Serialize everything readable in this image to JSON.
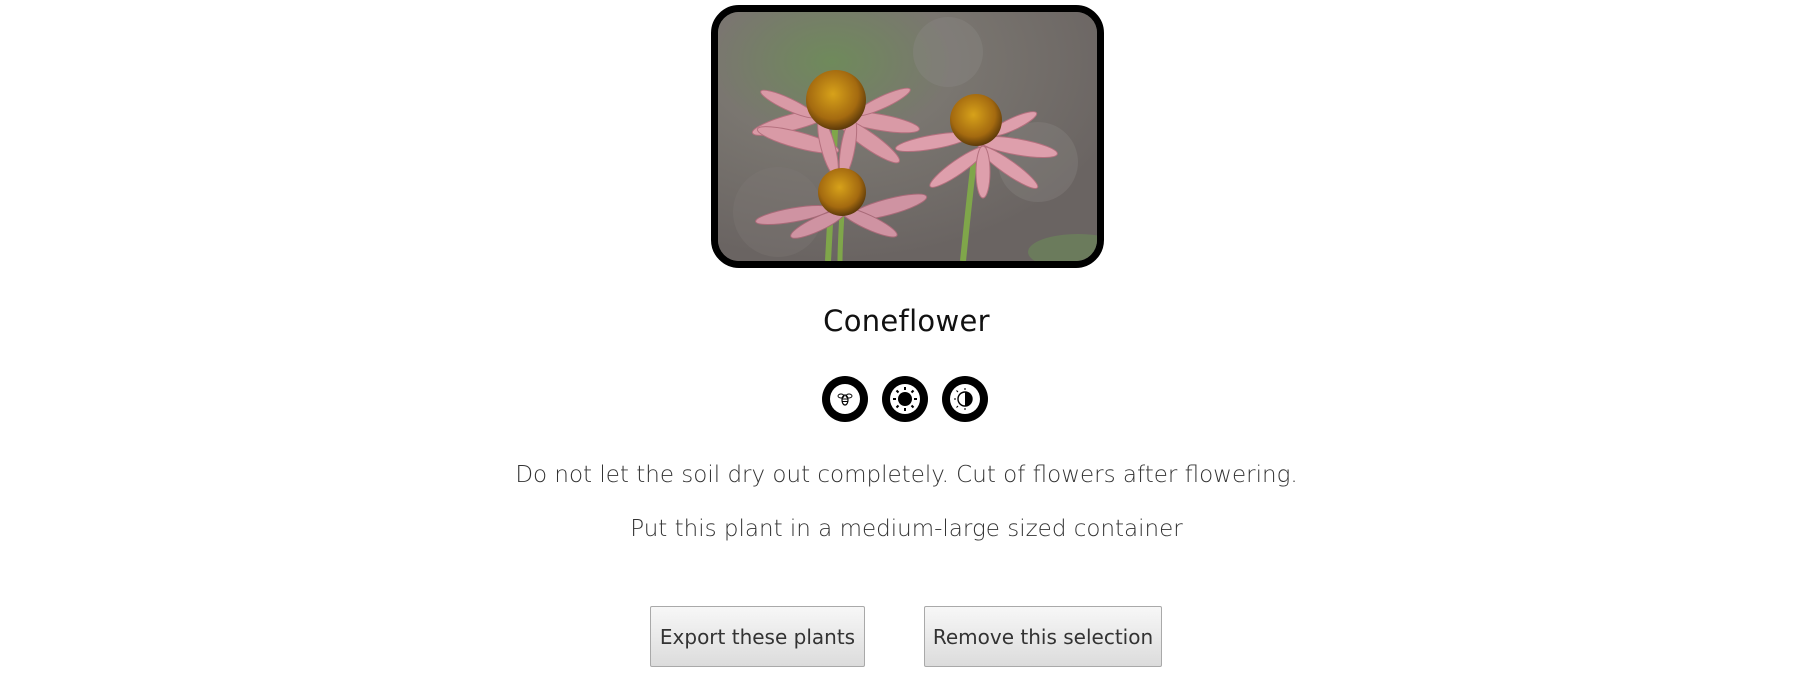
{
  "plant": {
    "name": "Coneflower",
    "image_subject": "pink coneflowers with orange centers",
    "care_icons": [
      "pollinator-icon",
      "full-sun-icon",
      "partial-shade-icon"
    ],
    "care_note": "Do not let the soil dry out completely. Cut of flowers after flowering.",
    "container_note": "Put this plant in a medium-large sized container"
  },
  "actions": {
    "export_label": "Export these plants",
    "remove_label": "Remove this selection"
  }
}
